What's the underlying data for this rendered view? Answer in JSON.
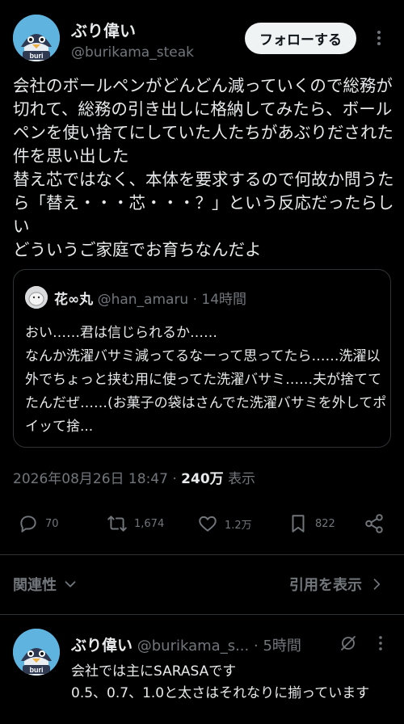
{
  "author": {
    "name": "ぶり偉い",
    "handle": "@burikama_steak",
    "avatar_label": "buri"
  },
  "follow_button": {
    "label": "フォローする"
  },
  "tweet": {
    "text": "会社のボールペンがどんどん減っていくので総務が切れて、総務の引き出しに格納してみたら、ボールペンを使い捨てにしていた人たちがあぶりだされた件を思い出した\n替え芯ではなく、本体を要求するので何故か問うたら「替え・・・芯・・・？」という反応だったらしい\nどういうご家庭でお育ちなんだよ"
  },
  "quote": {
    "name": "花∞丸",
    "handle": "@han_amaru",
    "separator": "·",
    "time": "14時間",
    "text": "おい……君は信じられるか……\nなんか洗濯バサミ減ってるなーって思ってたら……洗濯以外でちょっと挟む用に使ってた洗濯バサミ……夫が捨ててたんだぜ……(お菓子の袋はさんでた洗濯バサミを外してポイッて捨..."
  },
  "meta": {
    "timestamp": "2026年08月26日 18:47",
    "separator": "·",
    "views": "240万",
    "views_label": "表示"
  },
  "actions": {
    "replies": "70",
    "reposts": "1,674",
    "likes": "1.2万",
    "bookmarks": "822"
  },
  "tabs": {
    "related": "関連性",
    "quotes": "引用を表示"
  },
  "reply": {
    "name": "ぶり偉い",
    "handle": "@burikama_s...",
    "separator": "·",
    "time": "5時間",
    "text": "会社では主にSARASAです\n0.5、0.7、1.0と太さはそれなりに揃っています"
  },
  "colors": {
    "background": "#000000",
    "text": "#e7e9ea",
    "muted": "#71767b",
    "border": "#2f3336",
    "avatar": "#4aa8d8"
  }
}
